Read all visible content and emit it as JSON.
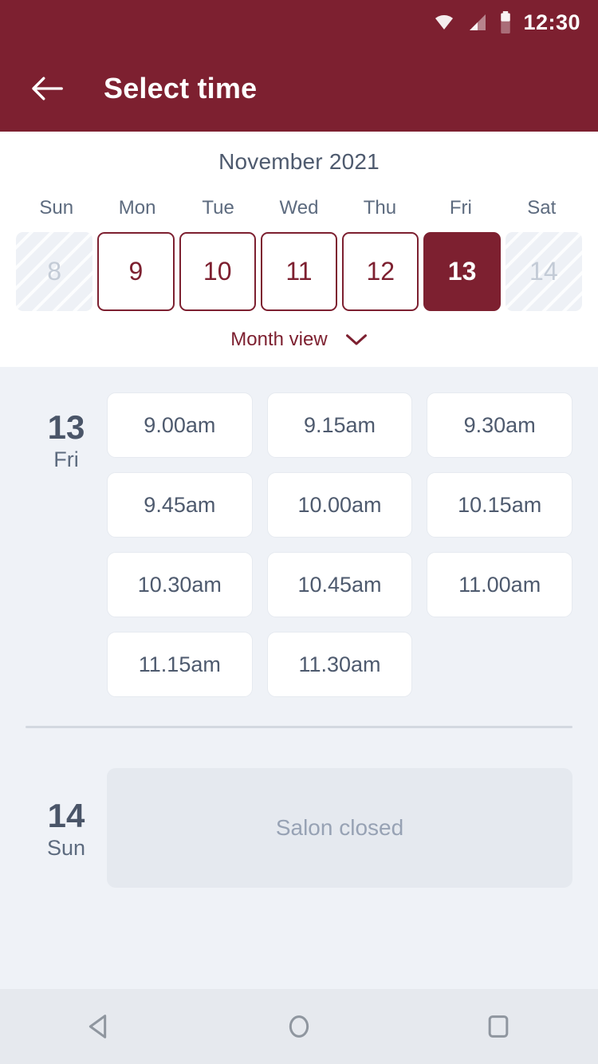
{
  "status_bar": {
    "time": "12:30",
    "icons": [
      "wifi-icon",
      "cellular-signal-icon",
      "battery-icon"
    ]
  },
  "app_bar": {
    "back_icon": "back-arrow-icon",
    "title": "Select time"
  },
  "calendar": {
    "month_title": "November 2021",
    "weekdays": [
      "Sun",
      "Mon",
      "Tue",
      "Wed",
      "Thu",
      "Fri",
      "Sat"
    ],
    "days": [
      {
        "number": "8",
        "state": "disabled"
      },
      {
        "number": "9",
        "state": "available"
      },
      {
        "number": "10",
        "state": "available"
      },
      {
        "number": "11",
        "state": "available"
      },
      {
        "number": "12",
        "state": "available"
      },
      {
        "number": "13",
        "state": "selected"
      },
      {
        "number": "14",
        "state": "disabled"
      }
    ],
    "month_view_label": "Month view",
    "month_view_icon": "chevron-down-icon"
  },
  "day_groups": [
    {
      "day_number": "13",
      "day_name": "Fri",
      "slots": [
        "9.00am",
        "9.15am",
        "9.30am",
        "9.45am",
        "10.00am",
        "10.15am",
        "10.30am",
        "10.45am",
        "11.00am",
        "11.15am",
        "11.30am"
      ],
      "closed_message": null
    },
    {
      "day_number": "14",
      "day_name": "Sun",
      "slots": [],
      "closed_message": "Salon closed"
    }
  ],
  "nav_bar": {
    "buttons": [
      {
        "name": "back-nav-button",
        "icon": "triangle-back-icon"
      },
      {
        "name": "home-nav-button",
        "icon": "circle-home-icon"
      },
      {
        "name": "recents-nav-button",
        "icon": "square-recents-icon"
      }
    ]
  },
  "colors": {
    "brand": "#7d2030",
    "content_bg": "#eff2f7",
    "text_dark": "#4e5a6e"
  }
}
